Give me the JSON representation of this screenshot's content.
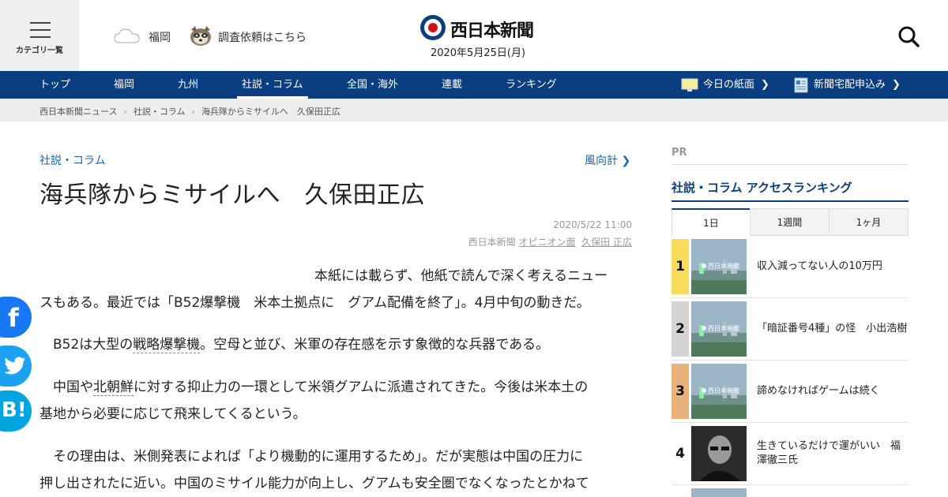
{
  "header": {
    "menu_label": "カテゴリ一覧",
    "weather_city": "福岡",
    "request_link": "調査依頼はこちら",
    "logo_text": "西日本新聞",
    "date": "2020年5月25日(月)"
  },
  "nav": {
    "items": [
      "トップ",
      "福岡",
      "九州",
      "社説・コラム",
      "全国・海外",
      "連載",
      "ランキング"
    ],
    "active_index": 3,
    "today_paper": "今日の紙面",
    "delivery": "新聞宅配申込み"
  },
  "breadcrumb": [
    "西日本新聞ニュース",
    "社説・コラム",
    "海兵隊からミサイルへ　久保田正広"
  ],
  "article": {
    "category": "社説・コラム",
    "column_link": "風向計",
    "title": "海兵隊からミサイルへ　久保田正広",
    "pubdate": "2020/5/22 11:00",
    "source_prefix": "西日本新聞",
    "source_section": "オピニオン面",
    "author": "久保田 正広",
    "p1_line1": "本紙には載らず、他紙で読んで深く考えるニュー",
    "p1_line2": "スもある。最近では「B52爆撃機　米本土拠点に　グアム配備を終了」。4月中旬の動きだ。",
    "p2_a": "B52は大型の",
    "p2_kw": "戦略爆撃機",
    "p2_b": "。空母と並び、米軍の存在感を示す象徴的な兵器である。",
    "p3_a": "中国や",
    "p3_kw": "北朝鮮",
    "p3_b": "に対する抑止力の一環として米領グアムに派遣されてきた。今後は米本土の",
    "p3_line2": "基地から必要に応じて飛来してくるという。",
    "p4_line1": "その理由は、米側発表によれば「より機動的に運用するため」。だが実態は中国の圧力に",
    "p4_line2": "押し出されたに近い。中国のミサイル能力が向上し、グアムも安全圏でなくなったとかねて"
  },
  "social": {
    "facebook": "f",
    "hatena": "B!"
  },
  "sidebar": {
    "pr_label": "PR",
    "ranking_title": "社説・コラム アクセスランキング",
    "tabs": [
      "1日",
      "1週間",
      "1ヶ月"
    ],
    "active_tab": 0,
    "thumb_logo": "西日本新聞",
    "ranks": [
      {
        "num": "1",
        "title": "収入減ってない人の10万円",
        "color": "#f6dc5a"
      },
      {
        "num": "2",
        "title": "「暗証番号4種」の怪　小出浩樹",
        "color": "#d3d3d3"
      },
      {
        "num": "3",
        "title": "諦めなければゲームは続く",
        "color": "#e9b27a"
      },
      {
        "num": "4",
        "title": "生きているだけで運がいい　福澤徹三氏",
        "color": "#ffffff"
      }
    ]
  },
  "colors": {
    "nav_bg": "#0b3e80",
    "link": "#1b63b2",
    "facebook": "#1877f2",
    "twitter": "#1da1f2",
    "hatena": "#00a4de"
  }
}
